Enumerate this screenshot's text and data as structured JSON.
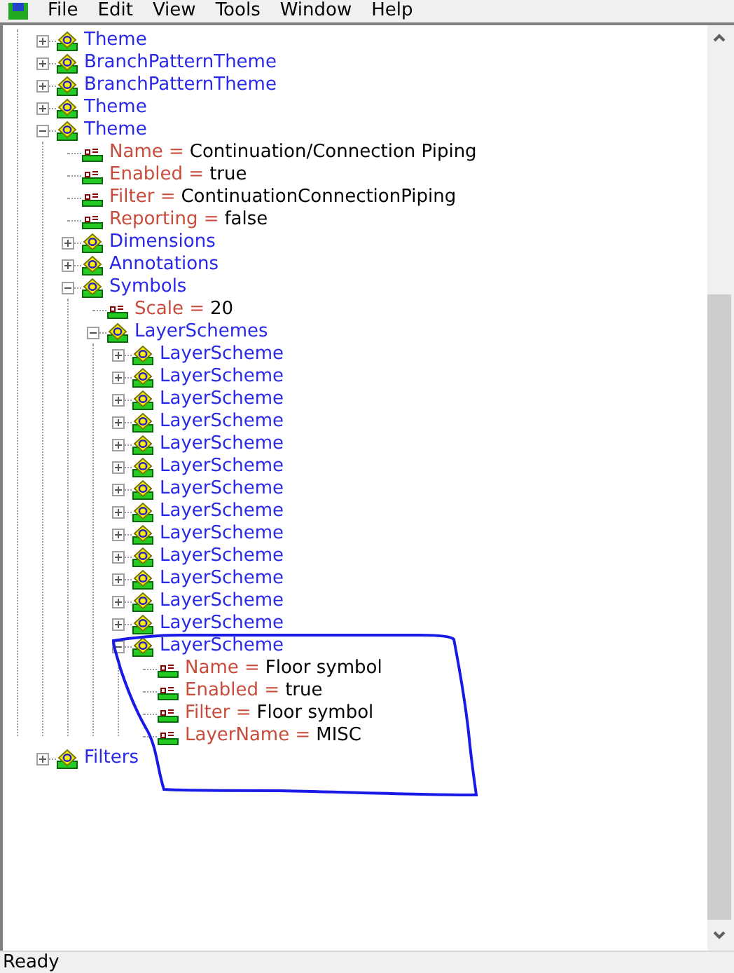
{
  "menu": [
    "File",
    "Edit",
    "View",
    "Tools",
    "Window",
    "Help"
  ],
  "tree": [
    {
      "kind": "offscreen",
      "children": [
        {
          "kind": "element",
          "label": "Theme",
          "expanded": false
        },
        {
          "kind": "element",
          "label": "BranchPatternTheme",
          "expanded": false
        },
        {
          "kind": "element",
          "label": "BranchPatternTheme",
          "expanded": false
        },
        {
          "kind": "element",
          "label": "Theme",
          "expanded": false
        },
        {
          "kind": "element",
          "label": "Theme",
          "expanded": true,
          "children": [
            {
              "kind": "property",
              "name": "Name =",
              "value": "Continuation/Connection Piping"
            },
            {
              "kind": "property",
              "name": "Enabled =",
              "value": "true"
            },
            {
              "kind": "property",
              "name": "Filter =",
              "value": "ContinuationConnectionPiping"
            },
            {
              "kind": "property",
              "name": "Reporting =",
              "value": "false"
            },
            {
              "kind": "element",
              "label": "Dimensions",
              "expanded": false
            },
            {
              "kind": "element",
              "label": "Annotations",
              "expanded": false
            },
            {
              "kind": "element",
              "label": "Symbols",
              "expanded": true,
              "children": [
                {
                  "kind": "property",
                  "name": "Scale =",
                  "value": "20"
                },
                {
                  "kind": "element",
                  "label": "LayerSchemes",
                  "expanded": true,
                  "children": [
                    {
                      "kind": "element",
                      "label": "LayerScheme",
                      "expanded": false
                    },
                    {
                      "kind": "element",
                      "label": "LayerScheme",
                      "expanded": false
                    },
                    {
                      "kind": "element",
                      "label": "LayerScheme",
                      "expanded": false
                    },
                    {
                      "kind": "element",
                      "label": "LayerScheme",
                      "expanded": false
                    },
                    {
                      "kind": "element",
                      "label": "LayerScheme",
                      "expanded": false
                    },
                    {
                      "kind": "element",
                      "label": "LayerScheme",
                      "expanded": false
                    },
                    {
                      "kind": "element",
                      "label": "LayerScheme",
                      "expanded": false
                    },
                    {
                      "kind": "element",
                      "label": "LayerScheme",
                      "expanded": false
                    },
                    {
                      "kind": "element",
                      "label": "LayerScheme",
                      "expanded": false
                    },
                    {
                      "kind": "element",
                      "label": "LayerScheme",
                      "expanded": false
                    },
                    {
                      "kind": "element",
                      "label": "LayerScheme",
                      "expanded": false
                    },
                    {
                      "kind": "element",
                      "label": "LayerScheme",
                      "expanded": false
                    },
                    {
                      "kind": "element",
                      "label": "LayerScheme",
                      "expanded": false
                    },
                    {
                      "kind": "element",
                      "label": "LayerScheme",
                      "expanded": true,
                      "children": [
                        {
                          "kind": "property",
                          "name": "Name =",
                          "value": "Floor symbol"
                        },
                        {
                          "kind": "property",
                          "name": "Enabled =",
                          "value": "true"
                        },
                        {
                          "kind": "property",
                          "name": "Filter =",
                          "value": "Floor symbol"
                        },
                        {
                          "kind": "property",
                          "name": "LayerName =",
                          "value": "MISC"
                        }
                      ]
                    }
                  ]
                }
              ]
            }
          ]
        }
      ]
    },
    {
      "kind": "element",
      "label": "Filters",
      "expanded": false
    }
  ],
  "status_bar": "Ready"
}
